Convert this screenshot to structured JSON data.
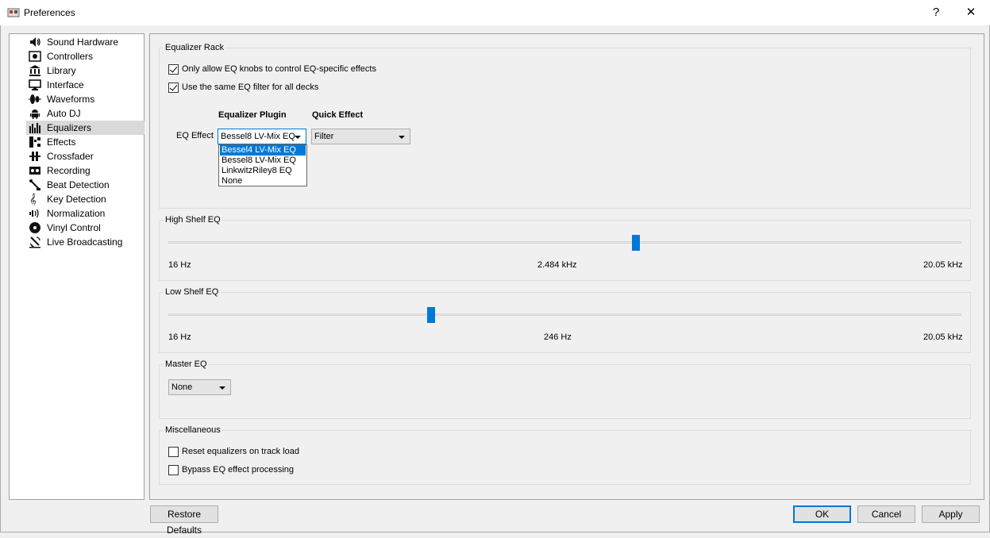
{
  "window": {
    "title": "Preferences",
    "help_glyph": "?",
    "close_glyph": "✕"
  },
  "sidebar": {
    "items": [
      {
        "label": "Sound Hardware",
        "icon": "speaker-icon"
      },
      {
        "label": "Controllers",
        "icon": "controller-icon"
      },
      {
        "label": "Library",
        "icon": "library-icon"
      },
      {
        "label": "Interface",
        "icon": "monitor-icon"
      },
      {
        "label": "Waveforms",
        "icon": "waveform-icon"
      },
      {
        "label": "Auto DJ",
        "icon": "robot-icon"
      },
      {
        "label": "Equalizers",
        "icon": "equalizer-icon"
      },
      {
        "label": "Effects",
        "icon": "effects-icon"
      },
      {
        "label": "Crossfader",
        "icon": "crossfader-icon"
      },
      {
        "label": "Recording",
        "icon": "recording-icon"
      },
      {
        "label": "Beat Detection",
        "icon": "beat-detection-icon"
      },
      {
        "label": "Key Detection",
        "icon": "key-detection-icon"
      },
      {
        "label": "Normalization",
        "icon": "normalization-icon"
      },
      {
        "label": "Vinyl Control",
        "icon": "vinyl-icon"
      },
      {
        "label": "Live Broadcasting",
        "icon": "broadcast-icon"
      }
    ],
    "selected": "Equalizers"
  },
  "equalizer_rack": {
    "title": "Equalizer Rack",
    "only_allow_eq_knobs": {
      "label": "Only allow EQ knobs to control EQ-specific effects",
      "checked": true
    },
    "same_eq_filter": {
      "label": "Use the same EQ filter for all decks",
      "checked": true
    },
    "plugin_header": "Equalizer Plugin",
    "quick_effect_header": "Quick Effect",
    "eq_effect_label": "EQ Effect",
    "plugin_value": "Bessel8 LV-Mix EQ",
    "quick_effect_value": "Filter",
    "plugin_options": [
      "Bessel4 LV-Mix EQ",
      "Bessel8 LV-Mix EQ",
      "LinkwitzRiley8 EQ",
      "None"
    ],
    "highlighted_option": "Bessel4 LV-Mix EQ"
  },
  "high_shelf": {
    "title": "High Shelf EQ",
    "min_label": "16 Hz",
    "value_label": "2.484 kHz",
    "max_label": "20.05 kHz",
    "position_fraction": 0.59
  },
  "low_shelf": {
    "title": "Low Shelf EQ",
    "min_label": "16 Hz",
    "value_label": "246 Hz",
    "max_label": "20.05 kHz",
    "position_fraction": 0.33
  },
  "master_eq": {
    "title": "Master EQ",
    "value": "None"
  },
  "misc": {
    "title": "Miscellaneous",
    "reset_on_load": {
      "label": "Reset equalizers on track load",
      "checked": false
    },
    "bypass_eq": {
      "label": "Bypass EQ effect processing",
      "checked": false
    }
  },
  "buttons": {
    "restore_defaults": "Restore Defaults",
    "ok": "OK",
    "cancel": "Cancel",
    "apply": "Apply"
  },
  "colors": {
    "accent": "#0078d7",
    "selected_row": "#d9d9d9"
  }
}
